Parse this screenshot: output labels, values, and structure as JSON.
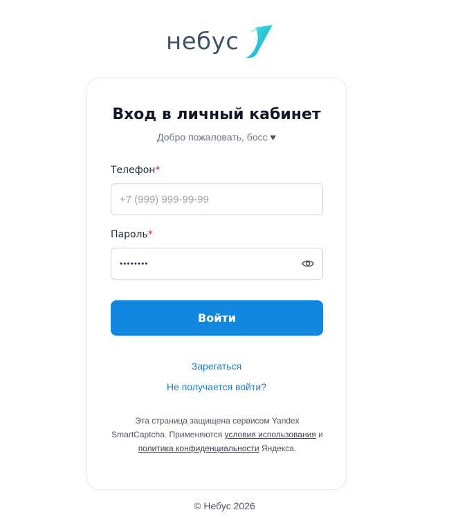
{
  "brand": {
    "name": "небус",
    "logo_icon": "swoosh-icon",
    "accent": "#1fc8d6"
  },
  "login": {
    "title": "Вход в личный кабинет",
    "subtitle": "Добро пожаловать, босс",
    "heart_icon": "heart-icon",
    "phone": {
      "label": "Телефон",
      "required_mark": "*",
      "placeholder": "+7 (999) 999-99-99",
      "value": ""
    },
    "password": {
      "label": "Пароль",
      "required_mark": "*",
      "value": "••••••••",
      "toggle_icon": "eye-icon"
    },
    "submit_label": "Войти",
    "register_link": "Зарегаться",
    "trouble_link": "Не получается войти?",
    "primary_color": "#1187e0"
  },
  "captcha": {
    "text_before": "Эта страница защищена сервисом Yandex SmartCaptcha. Применяются",
    "terms_link": "условия использования",
    "and": "и",
    "privacy_link": "политика конфиденциальности",
    "text_after": "Яндекса."
  },
  "footer": {
    "copyright": "© Небус 2026"
  }
}
